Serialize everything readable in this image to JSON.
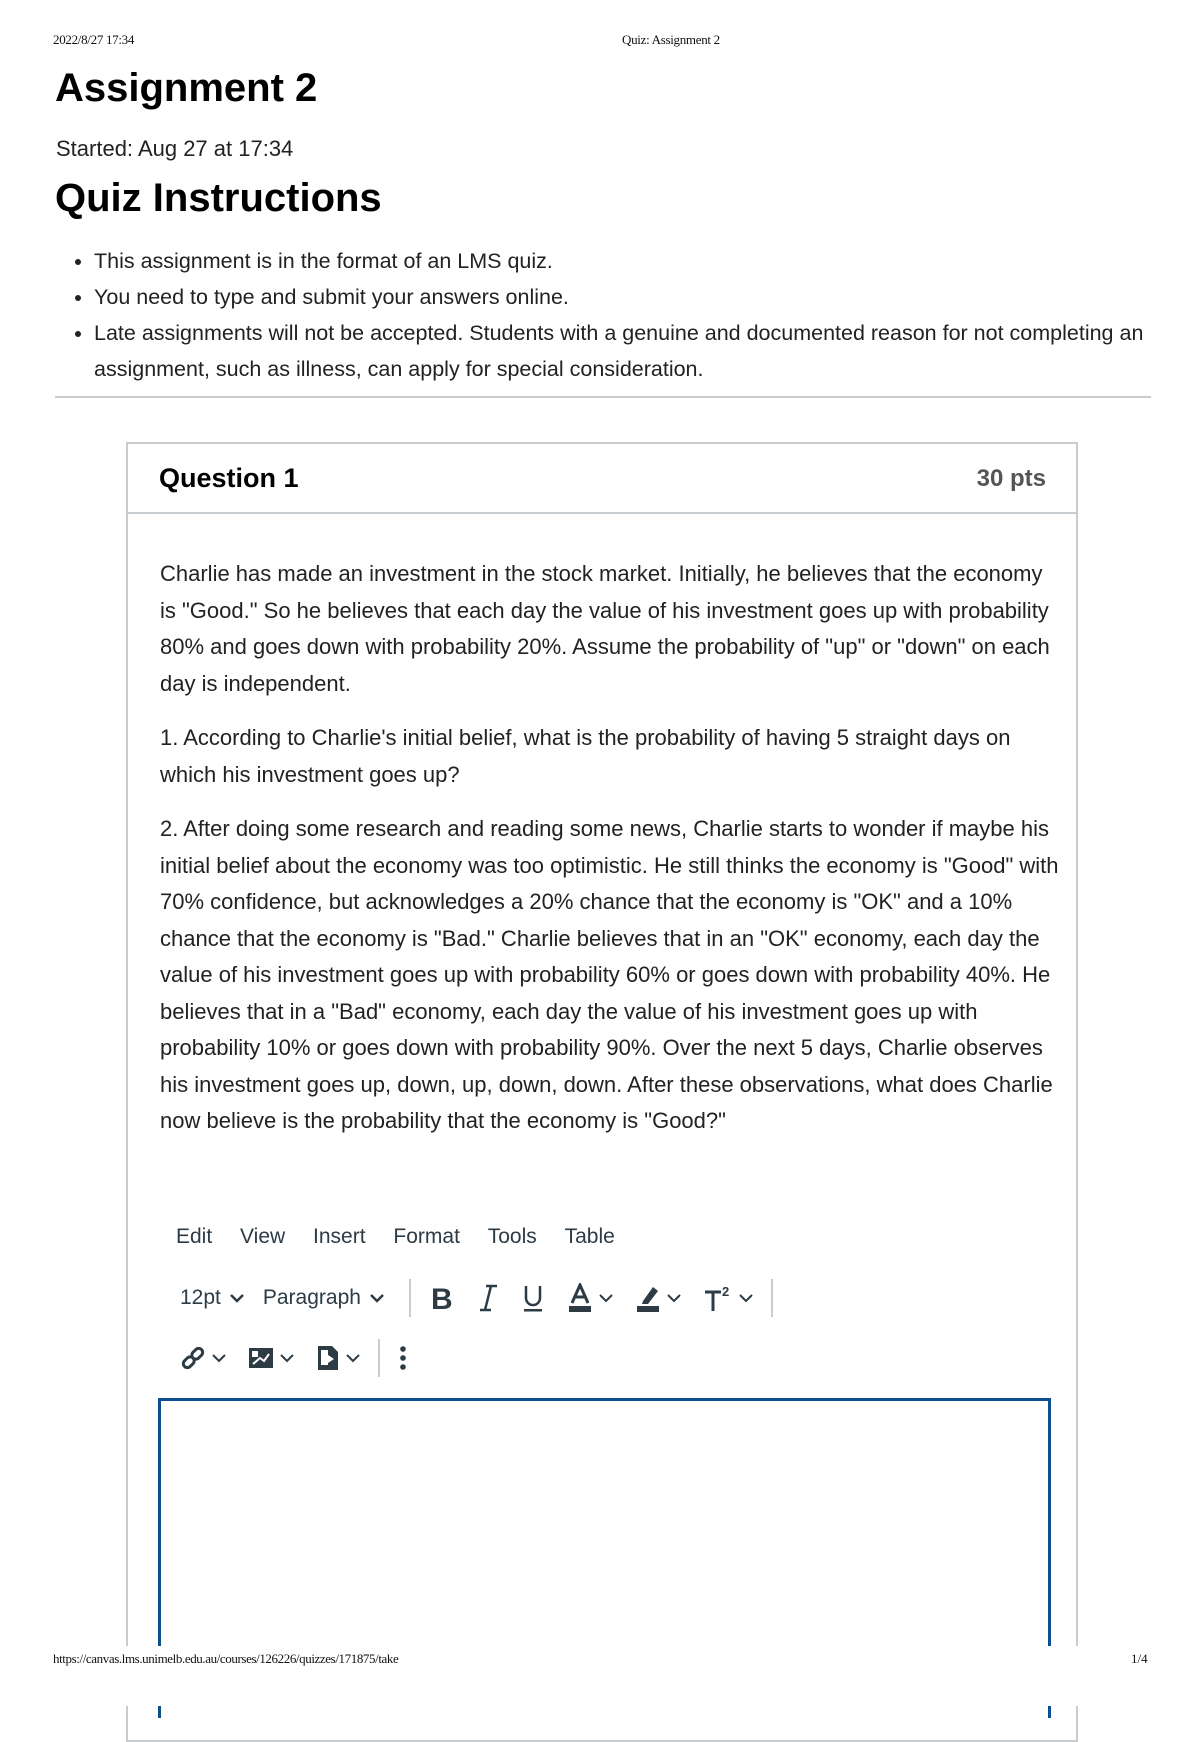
{
  "print_header": {
    "datetime": "2022/8/27 17:34",
    "doc_title": "Quiz: Assignment 2"
  },
  "page": {
    "title": "Assignment 2",
    "started": "Started: Aug 27 at 17:34",
    "instructions_title": "Quiz Instructions",
    "instructions": [
      "This assignment is in the format of an LMS quiz.",
      "You need to type and submit your answers online.",
      "Late assignments will not be accepted. Students with a genuine and documented reason for not completing an assignment, such as illness, can apply for special consideration."
    ]
  },
  "question": {
    "name": "Question 1",
    "points": "30 pts",
    "paragraphs": [
      "Charlie has made an investment in the stock market. Initially, he believes that the economy is \"Good.\" So he believes that each day the value of his investment goes up with probability 80% and goes down with probability 20%. Assume the probability of \"up\" or \"down\" on each day is independent.",
      "1. According to Charlie's initial belief, what is the probability of having 5 straight days on which his investment goes up?",
      "2. After doing some research and reading some news, Charlie starts to wonder if maybe his initial belief about the economy was too optimistic. He still thinks the economy is \"Good\" with 70% confidence, but acknowledges a 20% chance that the economy is \"OK\" and a 10% chance that the economy is \"Bad.\" Charlie believes that in an \"OK\" economy, each day the value of his investment goes up with probability 60% or goes down with probability 40%. He believes that in a \"Bad\" economy, each day the value of his investment goes up with probability 10% or goes down with probability 90%. Over the next 5 days, Charlie observes his investment goes up, down, up, down, down. After these observations, what does Charlie now believe is the probability that the economy is \"Good?\""
    ]
  },
  "editor": {
    "menu": [
      "Edit",
      "View",
      "Insert",
      "Format",
      "Tools",
      "Table"
    ],
    "font_size": "12pt",
    "block_format": "Paragraph",
    "toolbar_row1_icons": [
      "bold-icon",
      "italic-icon",
      "underline-icon",
      "text-color-icon",
      "highlight-icon",
      "superscript-icon"
    ],
    "toolbar_row2_icons": [
      "link-icon",
      "image-icon",
      "document-icon",
      "more-options-icon"
    ],
    "answer_value": "",
    "colors": {
      "icon": "#2d3b45",
      "answer_border": "#0e4d92",
      "separator": "#c7cdd1"
    }
  },
  "print_footer": {
    "url": "https://canvas.lms.unimelb.edu.au/courses/126226/quizzes/171875/take",
    "page": "1/4"
  }
}
